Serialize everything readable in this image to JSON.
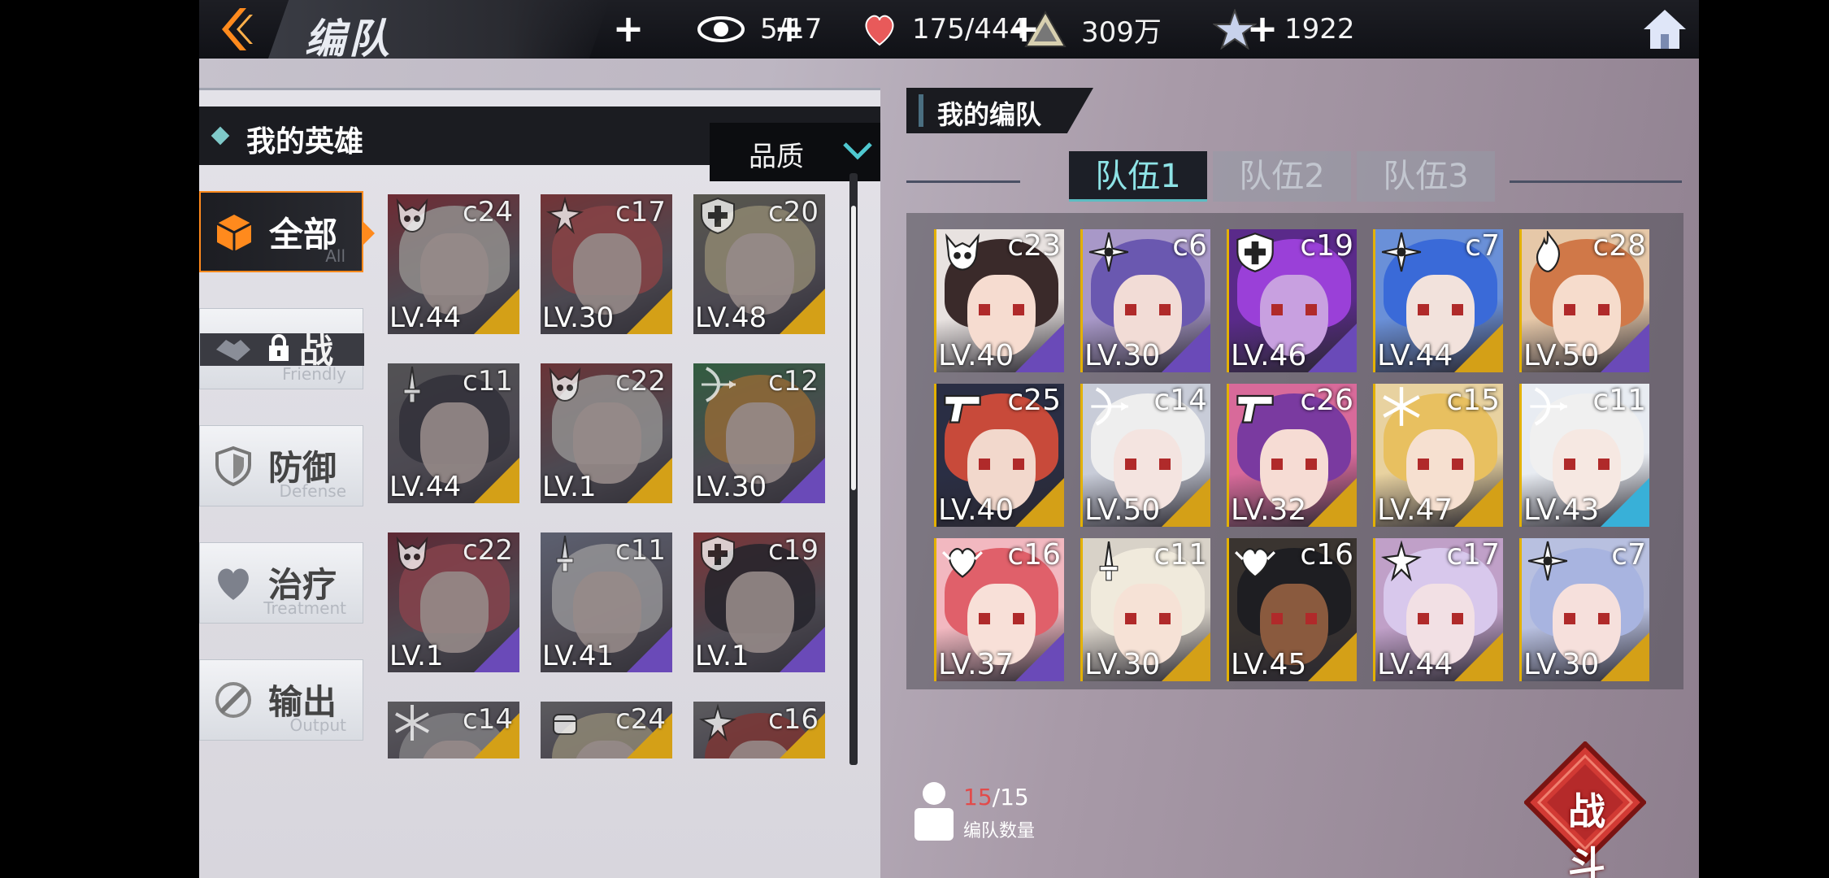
{
  "topbar": {
    "title": "编队",
    "resources": [
      {
        "icon": "eye-icon",
        "value": "5/17"
      },
      {
        "icon": "heart-icon",
        "value": "175/444"
      },
      {
        "icon": "triangle-crystal-icon",
        "value": "309万"
      },
      {
        "icon": "star-shard-icon",
        "value": "1922"
      }
    ]
  },
  "left": {
    "header_title": "我的英雄",
    "sort_label": "品质",
    "filters": [
      {
        "label": "全部",
        "sub": "All",
        "icon": "cube-icon"
      },
      {
        "label": "战",
        "sub": "Friendly",
        "icon": "handshake-icon"
      },
      {
        "label": "防御",
        "sub": "Defense",
        "icon": "shield-icon"
      },
      {
        "label": "治疗",
        "sub": "Treatment",
        "icon": "heart-icon"
      },
      {
        "label": "输出",
        "sub": "Output",
        "icon": "sword-icon"
      }
    ],
    "heroes": [
      {
        "cost": "c24",
        "lv": "LV.44",
        "class": "horned-skull-class-icon",
        "frame": "#d4a017",
        "hair": "#e8e4dc",
        "accent": "#a8303a"
      },
      {
        "cost": "c17",
        "lv": "LV.30",
        "class": "winged-star-class-icon",
        "frame": "#d4a017",
        "hair": "#d65a5a",
        "accent": "#b04040"
      },
      {
        "cost": "c20",
        "lv": "LV.48",
        "class": "cross-shield-class-icon",
        "frame": "#d4a017",
        "hair": "#e2d6a8",
        "accent": "#80806a"
      },
      {
        "cost": "c11",
        "lv": "LV.44",
        "class": "dagger-class-icon",
        "frame": "#d4a017",
        "hair": "#3a3a44",
        "accent": "#777"
      },
      {
        "cost": "c22",
        "lv": "LV.1",
        "class": "horned-skull-class-icon",
        "frame": "#d4a017",
        "hair": "#e8e6e0",
        "accent": "#a04040"
      },
      {
        "cost": "c12",
        "lv": "LV.30",
        "class": "bow-class-icon",
        "frame": "#6a4ab8",
        "hair": "#e8a040",
        "accent": "#3a8a50"
      },
      {
        "cost": "c22",
        "lv": "LV.1",
        "class": "horned-skull-class-icon",
        "frame": "#6a4ab8",
        "hair": "#d45a66",
        "accent": "#8a2a3a"
      },
      {
        "cost": "c11",
        "lv": "LV.41",
        "class": "dagger-class-icon",
        "frame": "#6a4ab8",
        "hair": "#ececec",
        "accent": "#8890a8"
      },
      {
        "cost": "c19",
        "lv": "LV.1",
        "class": "cross-shield-class-icon",
        "frame": "#6a4ab8",
        "hair": "#22222a",
        "accent": "#c04040"
      },
      {
        "cost": "c14",
        "lv": "",
        "class": "snowflake-class-icon",
        "frame": "#d4a017",
        "hair": "#c8c8c8",
        "accent": "#888"
      },
      {
        "cost": "c24",
        "lv": "",
        "class": "fist-class-icon",
        "frame": "#d4a017",
        "hair": "#e0d6b0",
        "accent": "#888"
      },
      {
        "cost": "c16",
        "lv": "",
        "class": "winged-star-class-icon",
        "frame": "#d4a017",
        "hair": "#c0443c",
        "accent": "#888"
      }
    ]
  },
  "right": {
    "team_label": "我的编队",
    "tabs": [
      "队伍1",
      "队伍2",
      "队伍3"
    ],
    "team": [
      {
        "cost": "c23",
        "lv": "LV.40",
        "class": "horned-skull-class-icon",
        "frame": "#6a4ab8",
        "hair": "#3a2a2a",
        "skin": "#f6dcd0",
        "bg": "#e8e2e0"
      },
      {
        "cost": "c6",
        "lv": "LV.30",
        "class": "shuriken-class-icon",
        "frame": "#6a4ab8",
        "hair": "#6a58b0",
        "skin": "#f2dcd6",
        "bg": "#a898c8"
      },
      {
        "cost": "c19",
        "lv": "LV.46",
        "class": "cross-shield-class-icon",
        "frame": "#6a4ab8",
        "hair": "#9a40d8",
        "skin": "#c8a0e0",
        "bg": "#5a2a8a"
      },
      {
        "cost": "c7",
        "lv": "LV.44",
        "class": "shuriken-class-icon",
        "frame": "#d4a017",
        "hair": "#3a6ad8",
        "skin": "#f2e2dc",
        "bg": "#6a90d8"
      },
      {
        "cost": "c28",
        "lv": "LV.50",
        "class": "flame-class-icon",
        "frame": "#6a4ab8",
        "hair": "#d07848",
        "skin": "#f6dccc",
        "bg": "#e6c8a8"
      },
      {
        "cost": "c25",
        "lv": "LV.40",
        "class": "pistol-class-icon",
        "frame": "#d4a017",
        "hair": "#c84a3a",
        "skin": "#f2d8cc",
        "bg": "#2a2e44"
      },
      {
        "cost": "c14",
        "lv": "LV.50",
        "class": "bow-class-icon",
        "frame": "#d4a017",
        "hair": "#eeeeee",
        "skin": "#f4e4e0",
        "bg": "#c8ccd8"
      },
      {
        "cost": "c26",
        "lv": "LV.32",
        "class": "pistol-class-icon",
        "frame": "#d4a017",
        "hair": "#7a3aa0",
        "skin": "#f6dcd4",
        "bg": "#d86a9a"
      },
      {
        "cost": "c15",
        "lv": "LV.47",
        "class": "snowflake-class-icon",
        "frame": "#d4a017",
        "hair": "#e8c060",
        "skin": "#f6e0d0",
        "bg": "#e8d2a0"
      },
      {
        "cost": "c11",
        "lv": "LV.43",
        "class": "bow-class-icon",
        "frame": "#38b0d8",
        "hair": "#f0f0f0",
        "skin": "#f6e8e2",
        "bg": "#e8ecf2"
      },
      {
        "cost": "c16",
        "lv": "LV.37",
        "class": "heart-wing-class-icon",
        "frame": "#6a4ab8",
        "hair": "#e0606a",
        "skin": "#f8e0d8",
        "bg": "#f2b8c0"
      },
      {
        "cost": "c11",
        "lv": "LV.30",
        "class": "dagger-class-icon",
        "frame": "#d4a017",
        "hair": "#f0eadc",
        "skin": "#f6e2d6",
        "bg": "#d8d2c8"
      },
      {
        "cost": "c16",
        "lv": "LV.45",
        "class": "heart-wing-class-icon",
        "frame": "#d4a017",
        "hair": "#1e1e22",
        "skin": "#8a5a3e",
        "bg": "#3a3430"
      },
      {
        "cost": "c17",
        "lv": "LV.44",
        "class": "winged-star-class-icon",
        "frame": "#d4a017",
        "hair": "#d8c8ec",
        "skin": "#f2e0e4",
        "bg": "#c0a0c8"
      },
      {
        "cost": "c7",
        "lv": "LV.30",
        "class": "shuriken-class-icon",
        "frame": "#d4a017",
        "hair": "#a8b4e0",
        "skin": "#f6e0dc",
        "bg": "#b8c0e0"
      }
    ],
    "count_current": "15",
    "count_total": "/15",
    "count_label": "编队数量",
    "battle_label": "战斗"
  },
  "colors": {
    "accent": "#ff8a1d",
    "tab_active": "#8ee3e6",
    "battle": "#b52a2a"
  }
}
